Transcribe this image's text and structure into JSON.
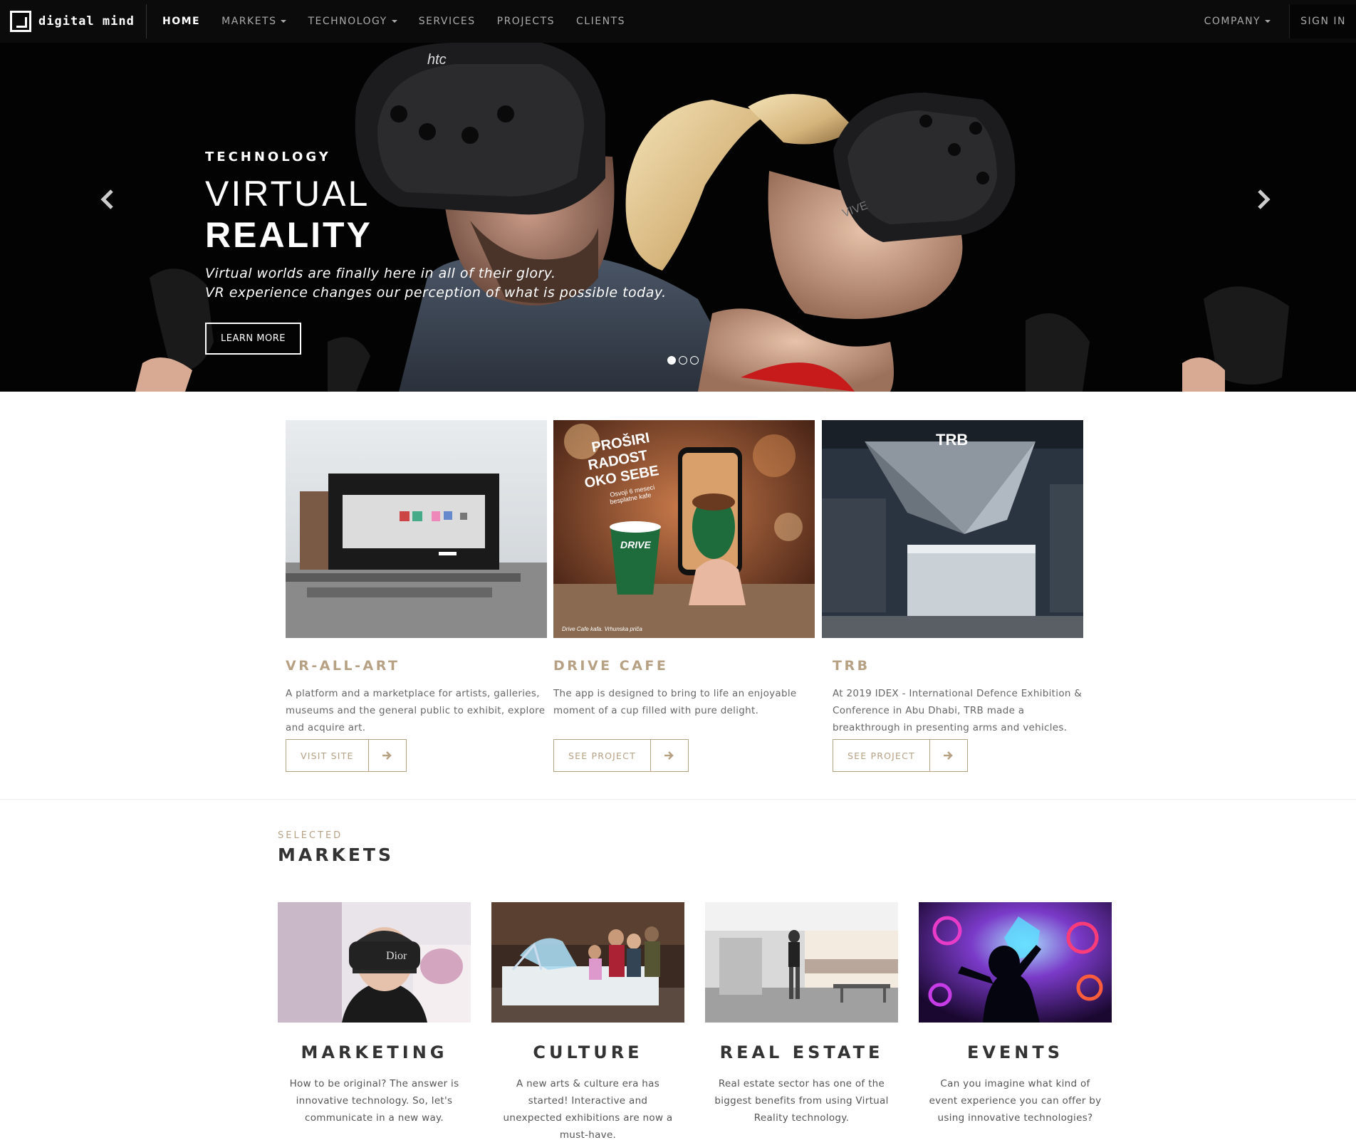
{
  "nav": {
    "logo_text": "digital mind",
    "items": [
      {
        "label": "HOME",
        "dropdown": false
      },
      {
        "label": "MARKETS",
        "dropdown": true
      },
      {
        "label": "TECHNOLOGY",
        "dropdown": true
      },
      {
        "label": "SERVICES",
        "dropdown": false
      },
      {
        "label": "PROJECTS",
        "dropdown": false
      },
      {
        "label": "CLIENTS",
        "dropdown": false
      }
    ],
    "company_label": "COMPANY",
    "signin_label": "SIGN IN"
  },
  "hero": {
    "eyebrow": "TECHNOLOGY",
    "title_light": "VIRTUAL",
    "title_bold": "REALITY",
    "text_line1": "Virtual worlds are finally here in all of their glory.",
    "text_line2": "VR experience changes our perception of what is possible today.",
    "button_label": "LEARN MORE",
    "slide_count": 3,
    "active_slide": 1
  },
  "projects": [
    {
      "title": "VR-ALL-ART",
      "description": "A platform and a marketplace for artists, galleries, museums and the general public to exhibit, explore and acquire art.",
      "button_label": "VISIT SITE"
    },
    {
      "title": "DRIVE CAFE",
      "description": "The app is designed to bring to life an enjoyable moment of a cup filled with pure delight.",
      "button_label": "SEE PROJECT",
      "image_text": {
        "line1": "PROŠIRI",
        "line2": "RADOST",
        "line3": "OKO SEBE",
        "sub1": "Osvoji 6 meseci",
        "sub2": "besplatne kafe",
        "footer": "Drive Cafe kafa. Vrhunska priča"
      }
    },
    {
      "title": "TRB",
      "description": "At 2019 IDEX - International Defence Exhibition & Conference in Abu Dhabi, TRB made a breakthrough in presenting arms and vehicles.",
      "button_label": "SEE PROJECT",
      "image_text": "TRB"
    }
  ],
  "markets": {
    "eyebrow": "SELECTED",
    "title": "MARKETS",
    "items": [
      {
        "title": "MARKETING",
        "description": "How to be original? The answer is innovative technology. So, let's communicate in a new way.",
        "image_text": "Dior"
      },
      {
        "title": "CULTURE",
        "description": "A new arts & culture era has started! Interactive and unexpected exhibitions are now a must-have."
      },
      {
        "title": "REAL ESTATE",
        "description": "Real estate sector has one of the biggest benefits from using Virtual Reality technology."
      },
      {
        "title": "EVENTS",
        "description": "Can you imagine what kind of event experience you can offer by using innovative technologies?"
      }
    ]
  },
  "colors": {
    "accent": "#b7a184",
    "nav_bg": "#0b0b0b"
  }
}
